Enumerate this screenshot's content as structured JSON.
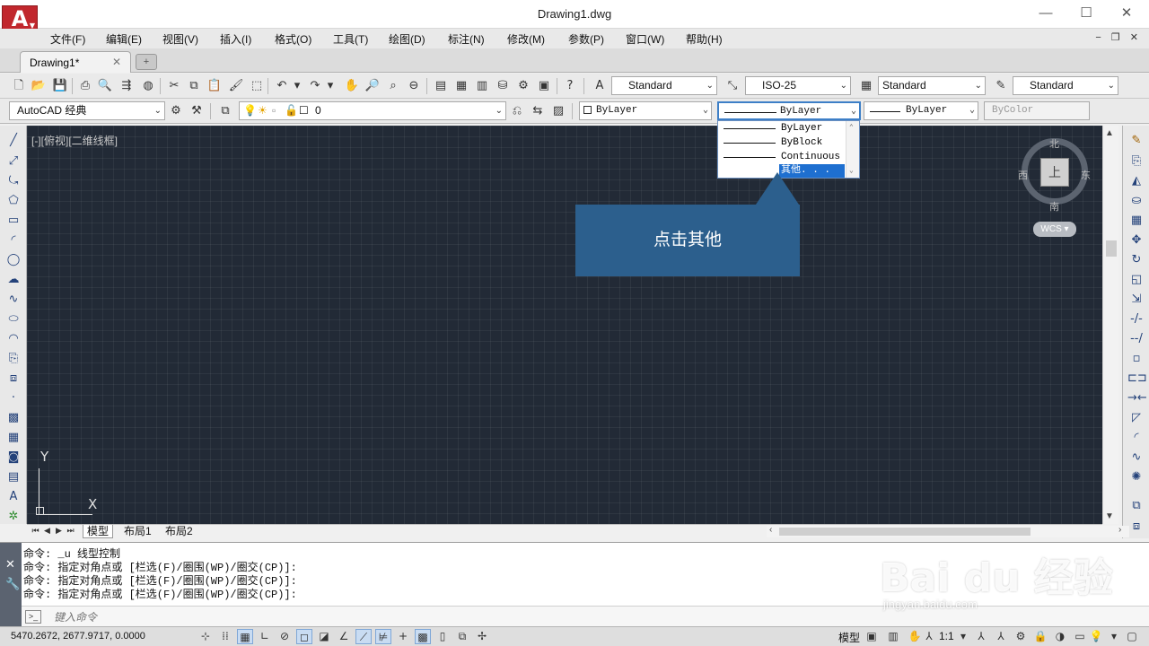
{
  "window": {
    "title": "Drawing1.dwg",
    "logo_letter": "A",
    "minimize": "—",
    "maximize": "☐",
    "close": "✕"
  },
  "menu": {
    "items": [
      "文件(F)",
      "编辑(E)",
      "视图(V)",
      "插入(I)",
      "格式(O)",
      "工具(T)",
      "绘图(D)",
      "标注(N)",
      "修改(M)",
      "参数(P)",
      "窗口(W)",
      "帮助(H)"
    ],
    "mdi_controls": "− ❐ ✕"
  },
  "tabs": {
    "file_tab": "Drawing1*",
    "close": "✕",
    "new_tab": "+"
  },
  "toolbar1": {
    "text_style": "Standard",
    "dim_style": "ISO-25",
    "table_style": "Standard",
    "multileader_style": "Standard"
  },
  "toolbar2": {
    "workspace": "AutoCAD 经典",
    "layer": "0",
    "color": "ByLayer",
    "linetype": "ByLayer",
    "lineweight": "ByLayer",
    "plot_style": "ByColor"
  },
  "linetype_dropdown": {
    "items": [
      "ByLayer",
      "ByBlock",
      "Continuous",
      "其他. . ."
    ],
    "selected": "其他. . ."
  },
  "canvas": {
    "viewport_label": "[-][俯视][二维线框]",
    "ucs_y": "Y",
    "ucs_x": "X"
  },
  "viewcube": {
    "north": "北",
    "south": "南",
    "east": "东",
    "west": "西",
    "top": "上",
    "wcs": "WCS ▾"
  },
  "callout": {
    "text": "点击其他"
  },
  "layout_tabs": [
    "模型",
    "布局1",
    "布局2"
  ],
  "command": {
    "history": [
      "命令: _u 线型控制",
      "命令: 指定对角点或 [栏选(F)/圈围(WP)/圈交(CP)]:",
      "命令: 指定对角点或 [栏选(F)/圈围(WP)/圈交(CP)]:",
      "命令: 指定对角点或 [栏选(F)/圈围(WP)/圈交(CP)]:"
    ],
    "placeholder": "键入命令",
    "prompt_icon": ">_"
  },
  "status": {
    "coordinates": "5470.2672, 2677.9717, 0.0000",
    "model_label": "模型",
    "scale": "1:1"
  },
  "watermark": {
    "main": "Bai du 经验",
    "sub": "jingyan.baidu.com"
  },
  "colors": {
    "canvas_bg": "#222a36",
    "callout_bg": "#2c5f8d",
    "selection": "#1e6fd0",
    "logo": "#c1272d"
  }
}
